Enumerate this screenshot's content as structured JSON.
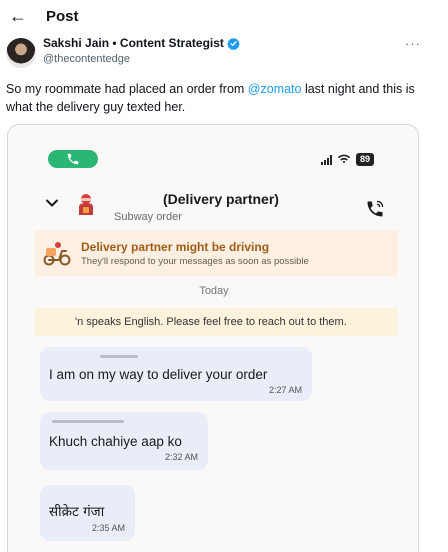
{
  "header": {
    "back_glyph": "←",
    "title": "Post"
  },
  "author": {
    "name": "Sakshi Jain • Content Strategist",
    "handle": "@thecontentedge",
    "verified": true,
    "more_glyph": "···"
  },
  "tweet": {
    "text_before": "So my roommate had placed an order from ",
    "mention": "@zomato",
    "text_after": " last night and this is what the delivery guy texted her."
  },
  "screenshot": {
    "status_bar": {
      "battery": "89"
    },
    "chat_header": {
      "title": "(Delivery partner)",
      "subtitle": "Subway order"
    },
    "driving_banner": {
      "title": "Delivery partner might be driving",
      "subtitle": "They'll respond to your messages as soon as possible"
    },
    "day_label": "Today",
    "language_note": "'n speaks English. Please feel free to reach out to them.",
    "messages": [
      {
        "text": "I am on my way to deliver your order",
        "time": "2:27 AM"
      },
      {
        "text": "Khuch chahiye aap ko",
        "time": "2:32 AM"
      },
      {
        "text": "सीक्रेट गंजा",
        "time": "2:35 AM"
      }
    ]
  },
  "colors": {
    "accent_link": "#1d9bf0",
    "verified_badge": "#1d9bf0",
    "call_pill": "#2bb673",
    "banner_bg": "#fdf0e2",
    "bubble_bg": "#e8edf8"
  }
}
